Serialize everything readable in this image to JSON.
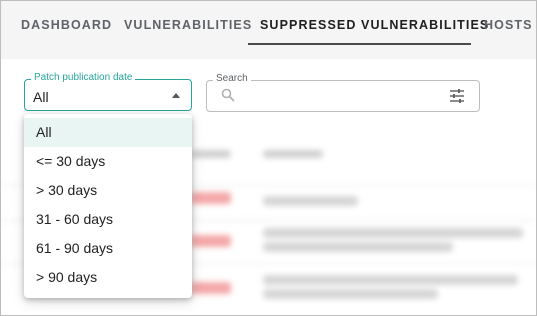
{
  "tabs": [
    {
      "label": "DASHBOARD"
    },
    {
      "label": "VULNERABILITIES"
    },
    {
      "label": "SUPPRESSED VULNERABILITIES",
      "active": true
    },
    {
      "label": "HOSTS"
    }
  ],
  "filters": {
    "patch_date": {
      "label": "Patch publication date",
      "value": "All",
      "options": [
        "All",
        "<= 30 days",
        "> 30 days",
        "31 - 60 days",
        "61 - 90 days",
        "> 90 days"
      ]
    },
    "search": {
      "label": "Search",
      "placeholder": ""
    }
  },
  "colors": {
    "accent": "#26a69a",
    "selected_bg": "#e8f5f3",
    "tab_bg": "#f5f5f5"
  },
  "icons": [
    "search-icon",
    "filter-settings-icon",
    "caret-up-icon"
  ]
}
